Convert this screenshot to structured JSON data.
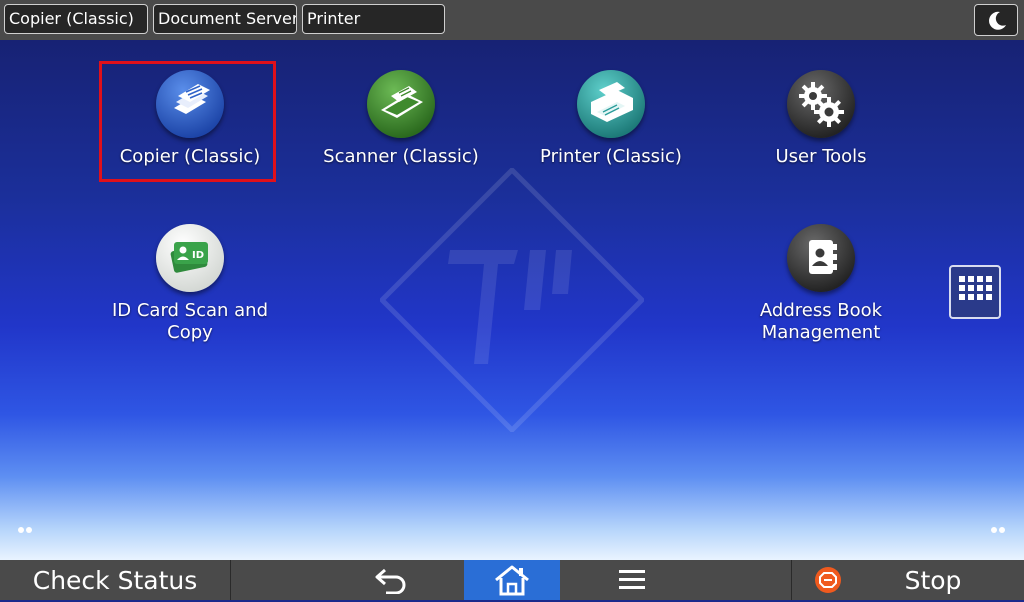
{
  "top_tabs": {
    "copier": "Copier (Classic)",
    "document_server": "Document Server",
    "printer": "Printer"
  },
  "apps": {
    "copier": "Copier (Classic)",
    "scanner": "Scanner (Classic)",
    "printer": "Printer (Classic)",
    "user_tools": "User Tools",
    "id_card": "ID Card Scan and Copy",
    "address_book_line1": "Address Book",
    "address_book_line2": "Management"
  },
  "bottom_bar": {
    "check_status": "Check Status",
    "stop": "Stop"
  },
  "icons": {
    "energy_saver": "moon-icon",
    "copier": "copier-icon",
    "scanner": "scanner-icon",
    "printer": "printer-icon",
    "user_tools": "gears-icon",
    "id_card": "id-card-icon",
    "address_book": "address-book-icon",
    "apps_grid": "grid-icon",
    "back": "back-arrow-icon",
    "home": "home-icon",
    "menu": "menu-icon",
    "stop": "stop-icon"
  },
  "colors": {
    "selection_frame": "#e0101a",
    "home_active": "#2a6ed6",
    "stop_accent": "#f05a1e",
    "copier_icon": "#2f62c9",
    "scanner_icon": "#3f8a2e",
    "printer_icon": "#2a9c9a",
    "user_tools_icon": "#3a3a3a",
    "id_card_icon": "#3aa34a"
  }
}
